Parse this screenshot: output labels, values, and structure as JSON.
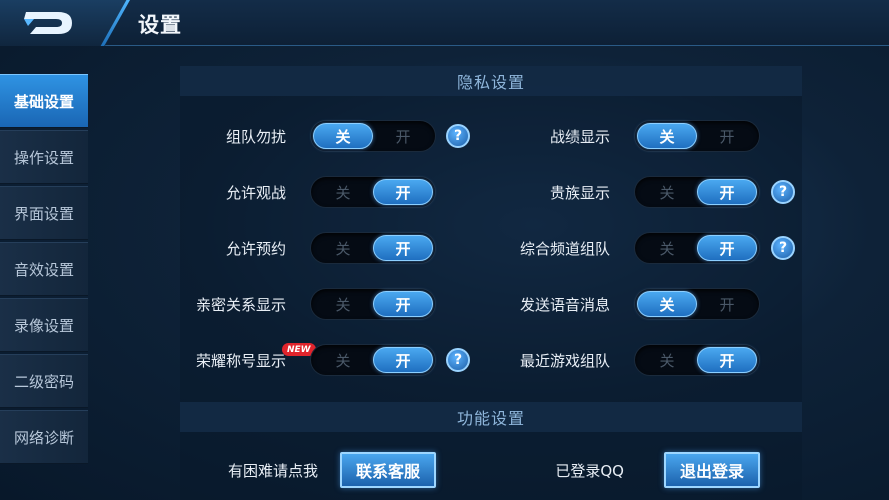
{
  "header": {
    "title": "设置"
  },
  "sidebar": {
    "items": [
      {
        "label": "基础设置",
        "active": true
      },
      {
        "label": "操作设置",
        "active": false
      },
      {
        "label": "界面设置",
        "active": false
      },
      {
        "label": "音效设置",
        "active": false
      },
      {
        "label": "录像设置",
        "active": false
      },
      {
        "label": "二级密码",
        "active": false
      },
      {
        "label": "网络诊断",
        "active": false
      }
    ]
  },
  "privacy": {
    "title": "隐私设置",
    "off_label": "关",
    "on_label": "开",
    "help_glyph": "?",
    "left": [
      {
        "label": "组队勿扰",
        "state": "off",
        "help": true
      },
      {
        "label": "允许观战",
        "state": "on",
        "help": false
      },
      {
        "label": "允许预约",
        "state": "on",
        "help": false
      },
      {
        "label": "亲密关系显示",
        "state": "on",
        "help": false
      },
      {
        "label": "荣耀称号显示",
        "state": "on",
        "help": true,
        "badge": "NEW"
      }
    ],
    "right": [
      {
        "label": "战绩显示",
        "state": "off",
        "help": false
      },
      {
        "label": "贵族显示",
        "state": "on",
        "help": true
      },
      {
        "label": "综合频道组队",
        "state": "on",
        "help": true
      },
      {
        "label": "发送语音消息",
        "state": "off",
        "help": false
      },
      {
        "label": "最近游戏组队",
        "state": "on",
        "help": false
      }
    ]
  },
  "function": {
    "title": "功能设置",
    "help_label": "有困难请点我",
    "contact_button": "联系客服",
    "login_label": "已登录QQ",
    "logout_button": "退出登录"
  },
  "colors": {
    "accent": "#2f93e3",
    "badge": "#e0242c"
  }
}
